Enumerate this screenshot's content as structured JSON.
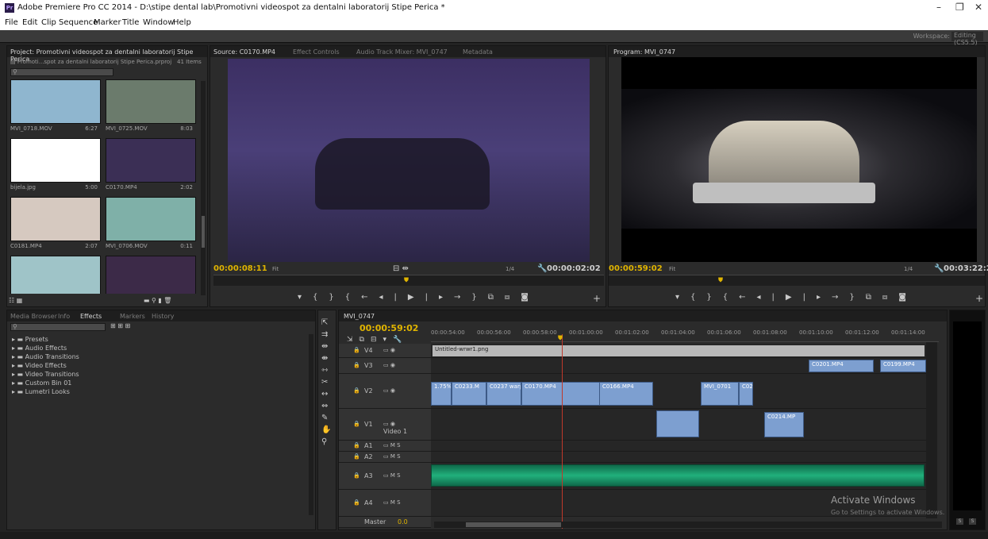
{
  "window": {
    "app_icon": "Pr",
    "title": "Adobe Premiere Pro CC 2014 - D:\\stipe dental lab\\Promotivni videospot za dentalni laboratorij Stipe Perica *",
    "controls": [
      "–",
      "❐",
      "✕"
    ]
  },
  "menu": [
    "File",
    "Edit",
    "Clip",
    "Sequence",
    "Marker",
    "Title",
    "Window",
    "Help"
  ],
  "workspace": {
    "label": "Workspace:",
    "value": "Editing (CS5.5)"
  },
  "project": {
    "tab": "Project: Promotivni videospot za dentalni laboratorij Stipe Perica",
    "file": "Promoti...spot za dentalni laboratorij Stipe Perica.prproj",
    "items_count": "41 Items",
    "thumbs": [
      {
        "name": "MVI_0718.MOV",
        "dur": "6:27",
        "color": "#8fb6cf"
      },
      {
        "name": "MVI_0725.MOV",
        "dur": "8:03",
        "color": "#6b7b6c"
      },
      {
        "name": "bijela.jpg",
        "dur": "5:00",
        "color": "#ffffff"
      },
      {
        "name": "C0170.MP4",
        "dur": "2:02",
        "color": "#3b2f55"
      },
      {
        "name": "C0181.MP4",
        "dur": "2:07",
        "color": "#d6c9c0"
      },
      {
        "name": "MVI_0706.MOV",
        "dur": "0:11",
        "color": "#7fb0a8"
      },
      {
        "name": "",
        "dur": "",
        "color": "#9fc4c8"
      },
      {
        "name": "",
        "dur": "",
        "color": "#3c2a48"
      }
    ]
  },
  "effects": {
    "tabs": [
      "Media Browser",
      "Info",
      "Effects",
      "Markers",
      "History"
    ],
    "active_tab": "Effects",
    "folders": [
      "Presets",
      "Audio Effects",
      "Audio Transitions",
      "Video Effects",
      "Video Transitions",
      "Custom Bin 01",
      "Lumetri Looks"
    ]
  },
  "source": {
    "tabs": [
      "Source: C0170.MP4",
      "Effect Controls",
      "Audio Track Mixer: MVI_0747",
      "Metadata"
    ],
    "timecode_in": "00:00:08:11",
    "fit": "Fit",
    "resolution": "1/4",
    "timecode_dur": "00:00:02:02"
  },
  "program": {
    "tab": "Program: MVI_0747",
    "timecode_in": "00:00:59:02",
    "fit": "Fit",
    "resolution": "1/4",
    "timecode_dur": "00:03:22:2"
  },
  "timeline": {
    "tab": "MVI_0747",
    "timecode": "00:00:59:02",
    "ruler": [
      "00:00:54:00",
      "00:00:56:00",
      "00:00:58:00",
      "00:01:00:00",
      "00:01:02:00",
      "00:01:04:00",
      "00:01:06:00",
      "00:01:08:00",
      "00:01:10:00",
      "00:01:12:00",
      "00:01:14:00"
    ],
    "video_tracks": [
      "V4",
      "V3",
      "V2",
      "V1"
    ],
    "v1_name": "Video 1",
    "audio_tracks": [
      "A1",
      "A2",
      "A3",
      "A4"
    ],
    "master": {
      "label": "Master",
      "value": "0.0"
    },
    "clips": {
      "v4_title": "Untitled-wrwr1.png",
      "v3_a": "C0201.MP4",
      "v3_b": "C0199.MP4",
      "v2_a": "1.75%]",
      "v2_b": "C0233.M",
      "v2_c": "C0237 warp",
      "v2_d": "C0170.MP4",
      "v2_e": "C0166.MP4",
      "v2_f": "MVI_0701",
      "v2_g": "C021",
      "v1_a": "C0214.MP"
    }
  },
  "watermark": {
    "line1": "Activate Windows",
    "line2": "Go to Settings to activate Windows."
  },
  "meters": [
    "S",
    "S"
  ]
}
